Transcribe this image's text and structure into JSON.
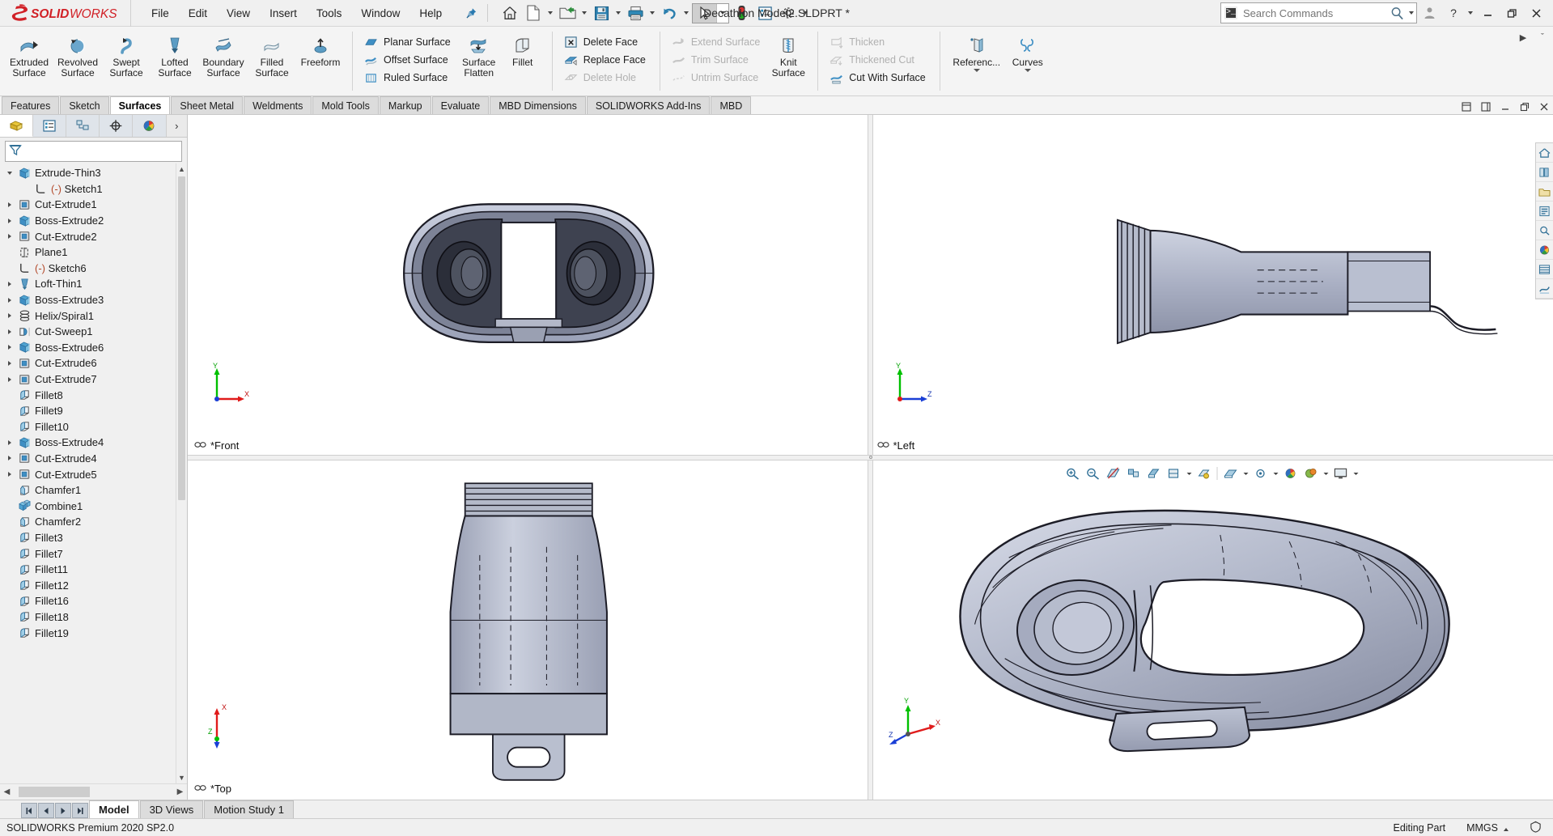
{
  "app": {
    "brand": "SOLIDWORKS",
    "document_title": "Decathlon Model2.SLDPRT *"
  },
  "menubar": {
    "items": [
      {
        "label": "File"
      },
      {
        "label": "Edit"
      },
      {
        "label": "View"
      },
      {
        "label": "Insert"
      },
      {
        "label": "Tools"
      },
      {
        "label": "Window"
      },
      {
        "label": "Help"
      }
    ],
    "pin_icon": "pushpin-icon"
  },
  "quick_access": {
    "buttons": [
      {
        "name": "home-icon",
        "label": "Home"
      },
      {
        "name": "new-document-icon",
        "label": "New"
      },
      {
        "name": "open-folder-icon",
        "label": "Open"
      },
      {
        "name": "save-icon",
        "label": "Save"
      },
      {
        "name": "print-icon",
        "label": "Print"
      },
      {
        "name": "undo-icon",
        "label": "Undo"
      },
      {
        "name": "select-cursor-icon",
        "label": "Select"
      },
      {
        "name": "rebuild-traffic-light-icon",
        "label": "Rebuild"
      },
      {
        "name": "file-properties-icon",
        "label": "File Properties"
      },
      {
        "name": "options-gear-icon",
        "label": "Options"
      }
    ]
  },
  "search": {
    "placeholder": "Search Commands",
    "value": "",
    "icon": "command-prompt-icon",
    "magnifier": "search-icon"
  },
  "window_controls": {
    "account": "user-account-icon",
    "help": "?",
    "minimize": "minimize-icon",
    "restore": "restore-icon",
    "close": "close-icon"
  },
  "ribbon": {
    "active_tab": "Surfaces",
    "big_buttons": [
      {
        "label": "Extruded\nSurface",
        "line1": "Extruded",
        "line2": "Surface",
        "icon": "extruded-surface-icon"
      },
      {
        "label": "Revolved Surface",
        "line1": "Revolved",
        "line2": "Surface",
        "icon": "revolved-surface-icon"
      },
      {
        "label": "Swept Surface",
        "line1": "Swept",
        "line2": "Surface",
        "icon": "swept-surface-icon"
      },
      {
        "label": "Lofted Surface",
        "line1": "Lofted",
        "line2": "Surface",
        "icon": "lofted-surface-icon"
      },
      {
        "label": "Boundary Surface",
        "line1": "Boundary",
        "line2": "Surface",
        "icon": "boundary-surface-icon"
      },
      {
        "label": "Filled Surface",
        "line1": "Filled",
        "line2": "Surface",
        "icon": "filled-surface-icon"
      },
      {
        "label": "Freeform",
        "line1": "Freeform",
        "line2": "",
        "icon": "freeform-icon"
      }
    ],
    "surface_stack": [
      {
        "label": "Planar Surface",
        "icon": "planar-surface-icon",
        "disabled": false
      },
      {
        "label": "Offset Surface",
        "icon": "offset-surface-icon",
        "disabled": false
      },
      {
        "label": "Ruled Surface",
        "icon": "ruled-surface-icon",
        "disabled": false
      }
    ],
    "surface_flatten": {
      "line1": "Surface",
      "line2": "Flatten",
      "icon": "surface-flatten-icon"
    },
    "fillet": {
      "line1": "Fillet",
      "line2": "",
      "icon": "fillet-icon"
    },
    "face_stack": [
      {
        "label": "Delete Face",
        "icon": "delete-face-icon",
        "disabled": false
      },
      {
        "label": "Replace Face",
        "icon": "replace-face-icon",
        "disabled": false
      },
      {
        "label": "Delete Hole",
        "icon": "delete-hole-icon",
        "disabled": true
      }
    ],
    "trim_stack": [
      {
        "label": "Extend Surface",
        "icon": "extend-surface-icon",
        "disabled": true
      },
      {
        "label": "Trim Surface",
        "icon": "trim-surface-icon",
        "disabled": true
      },
      {
        "label": "Untrim Surface",
        "icon": "untrim-surface-icon",
        "disabled": true
      }
    ],
    "knit": {
      "line1": "Knit",
      "line2": "Surface",
      "icon": "knit-surface-icon"
    },
    "thicken_stack": [
      {
        "label": "Thicken",
        "icon": "thicken-icon",
        "disabled": true
      },
      {
        "label": "Thickened Cut",
        "icon": "thickened-cut-icon",
        "disabled": true
      },
      {
        "label": "Cut With Surface",
        "icon": "cut-with-surface-icon",
        "disabled": false
      }
    ],
    "reference": {
      "line1": "Referenc...",
      "line2": "",
      "icon": "reference-geometry-icon"
    },
    "curves": {
      "line1": "Curves",
      "line2": "",
      "icon": "curves-icon"
    },
    "right_controls": [
      {
        "name": "ribbon-expand-icon",
        "glyph": "▶"
      },
      {
        "name": "ribbon-pin-icon",
        "glyph": "ˇ"
      }
    ]
  },
  "tabs": [
    {
      "label": "Features",
      "active": false
    },
    {
      "label": "Sketch",
      "active": false
    },
    {
      "label": "Surfaces",
      "active": true
    },
    {
      "label": "Sheet Metal",
      "active": false
    },
    {
      "label": "Weldments",
      "active": false
    },
    {
      "label": "Mold Tools",
      "active": false
    },
    {
      "label": "Markup",
      "active": false
    },
    {
      "label": "Evaluate",
      "active": false
    },
    {
      "label": "MBD Dimensions",
      "active": false
    },
    {
      "label": "SOLIDWORKS Add-Ins",
      "active": false
    },
    {
      "label": "MBD",
      "active": false
    }
  ],
  "tabbar_right_icons": [
    {
      "name": "restore-panel-icon",
      "glyph": "❐"
    },
    {
      "name": "maximize-panel-icon",
      "glyph": "❐"
    },
    {
      "name": "minimize-window-icon",
      "glyph": "—"
    },
    {
      "name": "restore-window-icon",
      "glyph": "❐"
    },
    {
      "name": "close-window-icon",
      "glyph": "✕"
    }
  ],
  "manager_tabs": [
    {
      "name": "feature-manager-tab",
      "label": "FeatureManager design tree",
      "active": true
    },
    {
      "name": "property-manager-tab",
      "label": "PropertyManager",
      "active": false
    },
    {
      "name": "configuration-manager-tab",
      "label": "ConfigurationManager",
      "active": false
    },
    {
      "name": "dimxpert-manager-tab",
      "label": "DimXpertManager",
      "active": false
    },
    {
      "name": "display-manager-tab",
      "label": "DisplayManager",
      "active": false
    }
  ],
  "filter": {
    "icon": "filter-funnel-icon",
    "placeholder": "",
    "value": ""
  },
  "feature_tree": [
    {
      "label": "Extrude-Thin3",
      "icon": "boss-extrude-icon",
      "indent": 0,
      "twisty": "open"
    },
    {
      "label": "(-) Sketch1",
      "icon": "sketch-icon",
      "indent": 1,
      "twisty": "none",
      "prefix": "(-) "
    },
    {
      "label": "Cut-Extrude1",
      "icon": "cut-extrude-icon",
      "indent": 0,
      "twisty": "closed"
    },
    {
      "label": "Boss-Extrude2",
      "icon": "boss-extrude-icon",
      "indent": 0,
      "twisty": "closed"
    },
    {
      "label": "Cut-Extrude2",
      "icon": "cut-extrude-icon",
      "indent": 0,
      "twisty": "closed"
    },
    {
      "label": "Plane1",
      "icon": "plane-icon",
      "indent": 0,
      "twisty": "none"
    },
    {
      "label": "(-) Sketch6",
      "icon": "sketch-icon",
      "indent": 0,
      "twisty": "none",
      "prefix": "(-) "
    },
    {
      "label": "Loft-Thin1",
      "icon": "loft-icon",
      "indent": 0,
      "twisty": "closed"
    },
    {
      "label": "Boss-Extrude3",
      "icon": "boss-extrude-icon",
      "indent": 0,
      "twisty": "closed"
    },
    {
      "label": "Helix/Spiral1",
      "icon": "helix-icon",
      "indent": 0,
      "twisty": "closed"
    },
    {
      "label": "Cut-Sweep1",
      "icon": "cut-sweep-icon",
      "indent": 0,
      "twisty": "closed"
    },
    {
      "label": "Boss-Extrude6",
      "icon": "boss-extrude-icon",
      "indent": 0,
      "twisty": "closed"
    },
    {
      "label": "Cut-Extrude6",
      "icon": "cut-extrude-icon",
      "indent": 0,
      "twisty": "closed"
    },
    {
      "label": "Cut-Extrude7",
      "icon": "cut-extrude-icon",
      "indent": 0,
      "twisty": "closed"
    },
    {
      "label": "Fillet8",
      "icon": "fillet-icon",
      "indent": 0,
      "twisty": "none"
    },
    {
      "label": "Fillet9",
      "icon": "fillet-icon",
      "indent": 0,
      "twisty": "none"
    },
    {
      "label": "Fillet10",
      "icon": "fillet-icon",
      "indent": 0,
      "twisty": "none"
    },
    {
      "label": "Boss-Extrude4",
      "icon": "boss-extrude-icon",
      "indent": 0,
      "twisty": "closed"
    },
    {
      "label": "Cut-Extrude4",
      "icon": "cut-extrude-icon",
      "indent": 0,
      "twisty": "closed"
    },
    {
      "label": "Cut-Extrude5",
      "icon": "cut-extrude-icon",
      "indent": 0,
      "twisty": "closed"
    },
    {
      "label": "Chamfer1",
      "icon": "chamfer-icon",
      "indent": 0,
      "twisty": "none"
    },
    {
      "label": "Combine1",
      "icon": "combine-icon",
      "indent": 0,
      "twisty": "none"
    },
    {
      "label": "Chamfer2",
      "icon": "chamfer-icon",
      "indent": 0,
      "twisty": "none"
    },
    {
      "label": "Fillet3",
      "icon": "fillet-icon",
      "indent": 0,
      "twisty": "none"
    },
    {
      "label": "Fillet7",
      "icon": "fillet-icon",
      "indent": 0,
      "twisty": "none"
    },
    {
      "label": "Fillet11",
      "icon": "fillet-icon",
      "indent": 0,
      "twisty": "none"
    },
    {
      "label": "Fillet12",
      "icon": "fillet-icon",
      "indent": 0,
      "twisty": "none"
    },
    {
      "label": "Fillet16",
      "icon": "fillet-icon",
      "indent": 0,
      "twisty": "none"
    },
    {
      "label": "Fillet18",
      "icon": "fillet-icon",
      "indent": 0,
      "twisty": "none"
    },
    {
      "label": "Fillet19",
      "icon": "fillet-icon",
      "indent": 0,
      "twisty": "none"
    }
  ],
  "viewports": [
    {
      "name": "viewport-front",
      "label": "*Front",
      "triad": {
        "up": "Y",
        "right": "X"
      }
    },
    {
      "name": "viewport-left",
      "label": "*Left",
      "triad": {
        "up": "Y",
        "right": "Z"
      }
    },
    {
      "name": "viewport-top",
      "label": "*Top",
      "triad": {
        "up": "Z",
        "right": "X"
      }
    },
    {
      "name": "viewport-isometric",
      "label": "",
      "triad": {
        "up": "Y",
        "right": "X",
        "third": "Z"
      }
    }
  ],
  "view_toolbar": [
    {
      "name": "zoom-to-fit-icon",
      "caret": false
    },
    {
      "name": "zoom-to-area-icon",
      "caret": false
    },
    {
      "name": "section-view-icon",
      "caret": false
    },
    {
      "name": "view-orientation-icon",
      "caret": false
    },
    {
      "name": "display-style-icon",
      "caret": false
    },
    {
      "name": "hide-show-items-icon",
      "caret": true
    },
    {
      "name": "edit-appearance-icon",
      "caret": true
    },
    {
      "name": "apply-scene-icon",
      "caret": true
    },
    {
      "name": "view-settings-icon",
      "caret": false
    },
    {
      "name": "appearances-icon",
      "caret": false
    },
    {
      "name": "scenes-icon",
      "caret": true
    },
    {
      "name": "viewport-layout-icon",
      "caret": true
    }
  ],
  "right_dock": [
    {
      "name": "view-palette-home-icon"
    },
    {
      "name": "appearances-library-icon"
    },
    {
      "name": "design-library-icon"
    },
    {
      "name": "file-explorer-icon"
    },
    {
      "name": "search-library-icon"
    },
    {
      "name": "view-palette-icon"
    },
    {
      "name": "appearances-scenes-icon"
    },
    {
      "name": "custom-properties-icon"
    }
  ],
  "bottom": {
    "nav_buttons": [
      {
        "name": "first-config-button",
        "glyph": "⏮"
      },
      {
        "name": "prev-config-button",
        "glyph": "◀"
      },
      {
        "name": "next-config-button",
        "glyph": "▶"
      },
      {
        "name": "last-config-button",
        "glyph": "⏭"
      }
    ],
    "tabs": [
      {
        "label": "Model",
        "active": true
      },
      {
        "label": "3D Views",
        "active": false
      },
      {
        "label": "Motion Study 1",
        "active": false
      }
    ]
  },
  "statusbar": {
    "version": "SOLIDWORKS Premium 2020 SP2.0",
    "mode": "Editing Part",
    "units": "MMGS",
    "units_caret": "▴",
    "overlay_icon": "overlay-icon"
  },
  "colors": {
    "accent_red": "#d12026",
    "icon_blue": "#3f8fc4",
    "model_body": "#b8bdd0",
    "model_edge": "#1d1d27",
    "axis_x": "#e01b1b",
    "axis_y": "#00c000",
    "axis_z": "#1a3fd6"
  }
}
